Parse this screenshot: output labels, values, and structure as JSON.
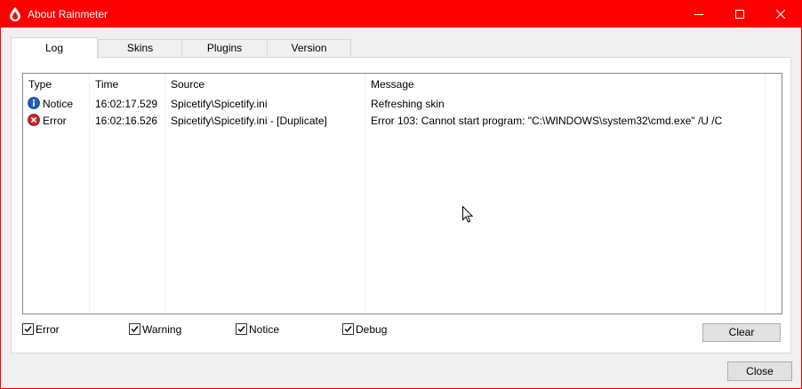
{
  "window": {
    "title": "About Rainmeter"
  },
  "tabs": [
    "Log",
    "Skins",
    "Plugins",
    "Version"
  ],
  "log": {
    "columns": [
      "Type",
      "Time",
      "Source",
      "Message"
    ],
    "rows": [
      {
        "icon": "info-icon",
        "type": "Notice",
        "time": "16:02:17.529",
        "source": "Spicetify\\Spicetify.ini",
        "message": "Refreshing skin"
      },
      {
        "icon": "error-icon",
        "type": "Error",
        "time": "16:02:16.526",
        "source": "Spicetify\\Spicetify.ini - [Duplicate]",
        "message": "Error 103: Cannot start program: \"C:\\WINDOWS\\system32\\cmd.exe\" /U /C"
      }
    ]
  },
  "filters": [
    {
      "label": "Error",
      "checked": true
    },
    {
      "label": "Warning",
      "checked": true
    },
    {
      "label": "Notice",
      "checked": true
    },
    {
      "label": "Debug",
      "checked": true
    }
  ],
  "buttons": {
    "clear": "Clear",
    "close": "Close"
  },
  "colors": {
    "titlebar": "#ff0000",
    "info": "#1e5fb4",
    "error": "#c0282d"
  }
}
